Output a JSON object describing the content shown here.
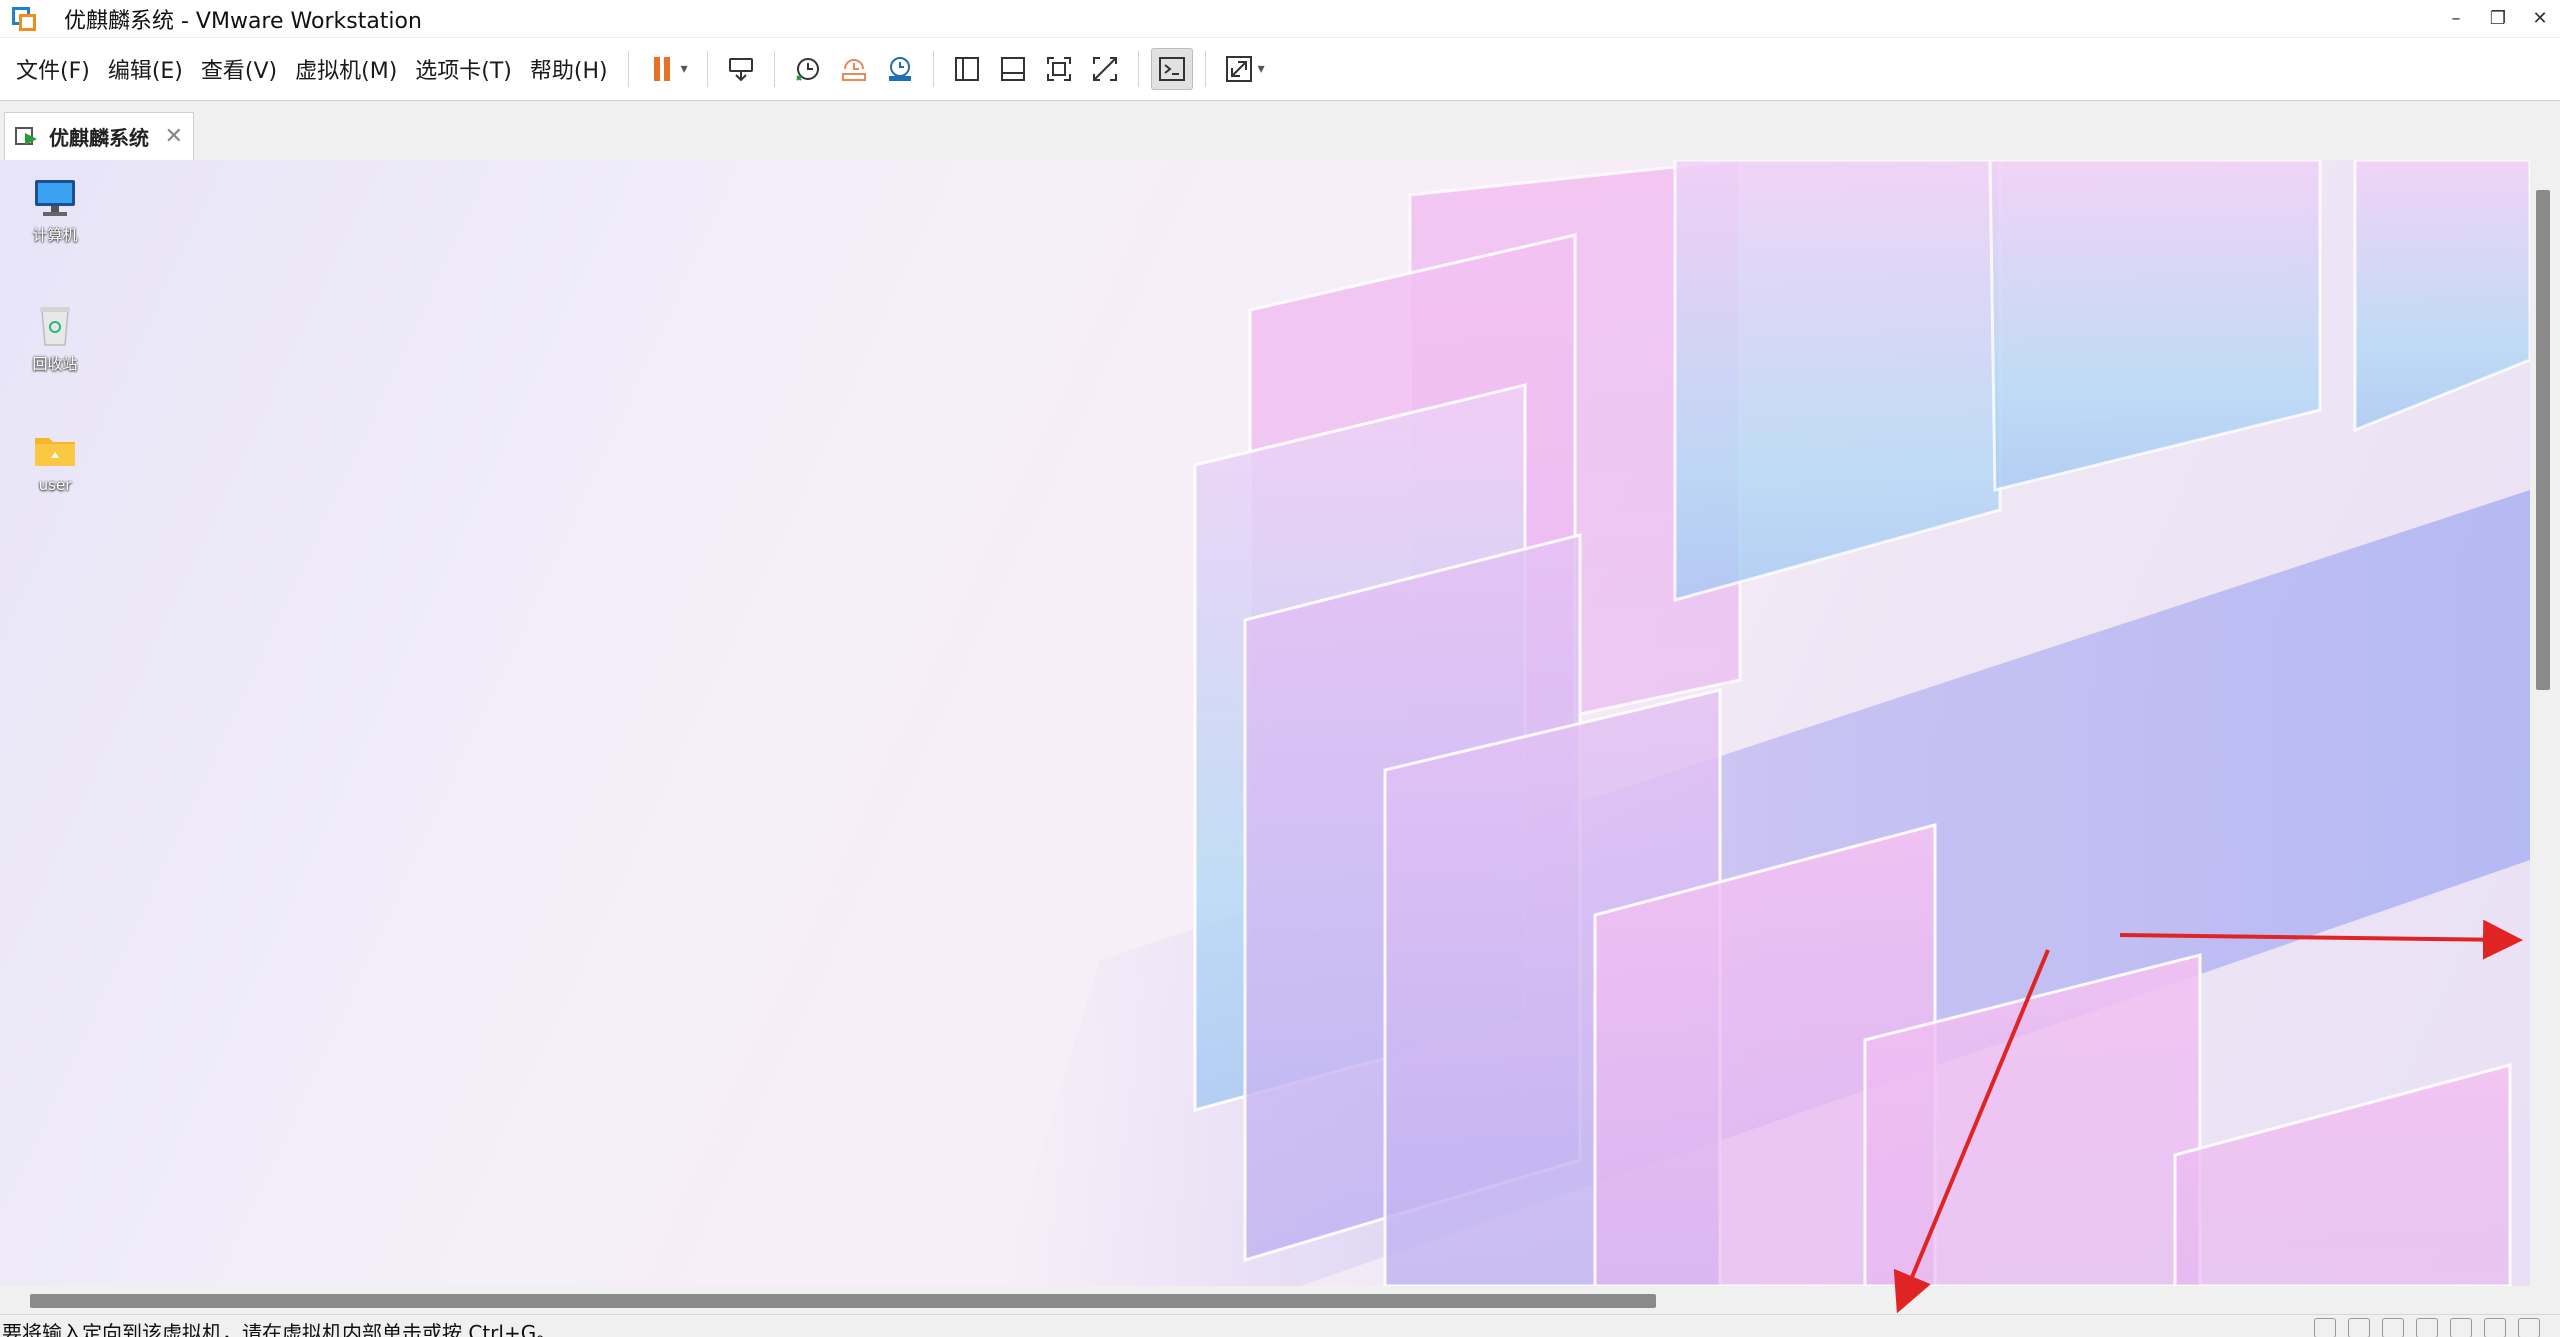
{
  "window": {
    "title": "优麒麟系统 - VMware Workstation",
    "minimize_glyph": "–",
    "restore_glyph": "❐",
    "close_glyph": "✕"
  },
  "menu": {
    "items": [
      "文件(F)",
      "编辑(E)",
      "查看(V)",
      "虚拟机(M)",
      "选项卡(T)",
      "帮助(H)"
    ]
  },
  "toolbar": {
    "icons": [
      "pause-icon",
      "send-ctrl-alt-del-icon",
      "snapshot-icon",
      "revert-snapshot-icon",
      "snapshot-manager-icon",
      "show-library-icon",
      "show-thumbnail-icon",
      "fullscreen-icon",
      "unity-icon",
      "console-view-icon",
      "stretch-guest-icon"
    ],
    "dropdown_glyph": "▾"
  },
  "tab": {
    "label": "优麒麟系统",
    "close_glyph": "✕"
  },
  "desktop": {
    "icons": [
      {
        "label": "计算机",
        "icon": "computer-icon"
      },
      {
        "label": "回收站",
        "icon": "recycle-bin-icon"
      },
      {
        "label": "user",
        "icon": "folder-icon"
      }
    ]
  },
  "statusbar": {
    "text": "要将输入定向到该虚拟机，请在虚拟机内部单击或按 Ctrl+G。"
  },
  "colors": {
    "accent_pause": "#e8712a",
    "annotation_arrow": "#e02424",
    "vmware_blue": "#1f7fd1",
    "vmware_orange": "#f28c1b"
  }
}
